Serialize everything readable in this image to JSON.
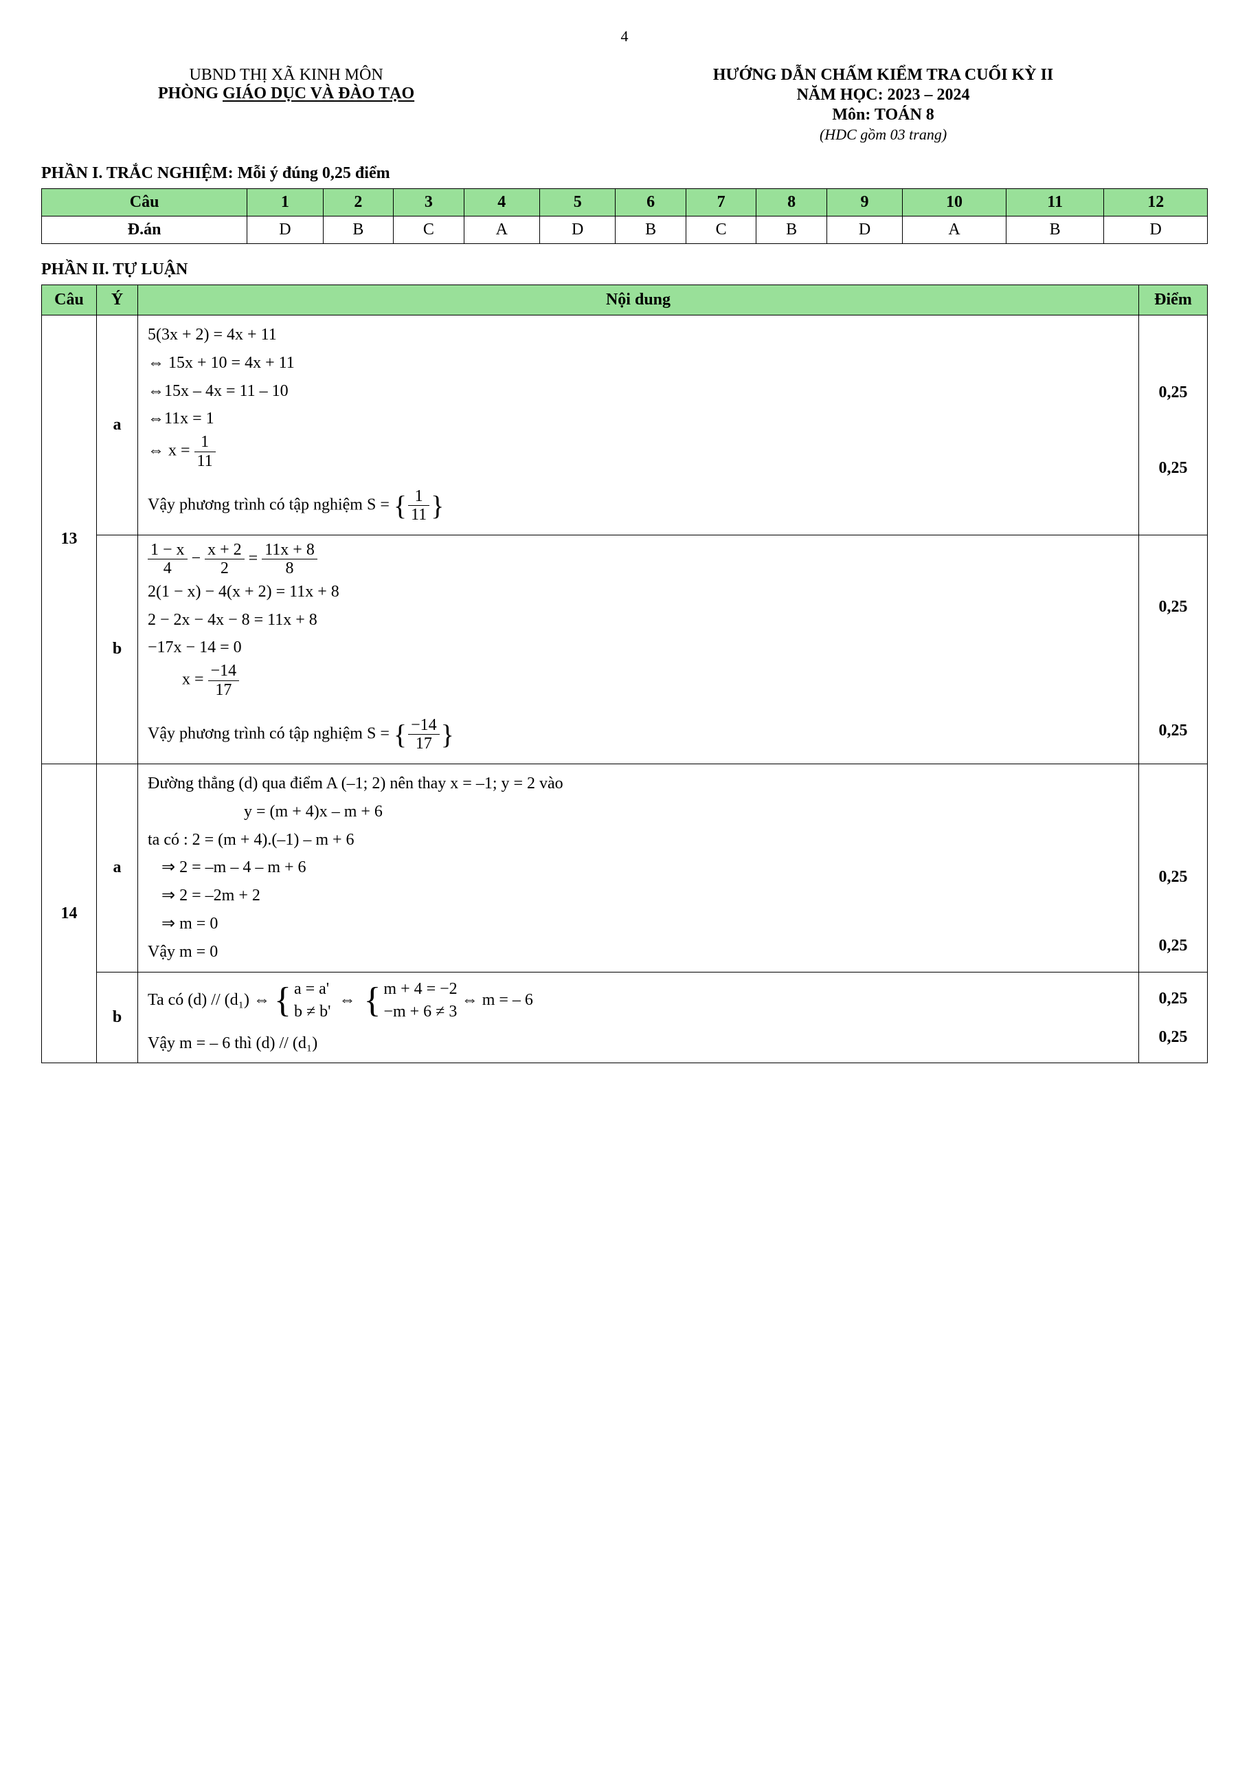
{
  "page_number": "4",
  "header": {
    "left_line1": "UBND THỊ XÃ KINH MÔN",
    "left_line2_prefix": "PHÒNG ",
    "left_line2_underline": "GIÁO DỤC VÀ ĐÀO TẠO",
    "right_line1": "HƯỚNG DẪN CHẤM KIỂM TRA CUỐI KỲ II",
    "right_line2": "NĂM HỌC: 2023 – 2024",
    "right_line3": "Môn:  TOÁN 8",
    "right_line4": "(HDC gồm 03 trang)"
  },
  "section1_title": "PHẦN I. TRẮC NGHIỆM: Mỗi ý đúng 0,25 điểm",
  "mc_table": {
    "row1_label": "Câu",
    "questions": [
      "1",
      "2",
      "3",
      "4",
      "5",
      "6",
      "7",
      "8",
      "9",
      "10",
      "11",
      "12"
    ],
    "row2_label": "Đ.án",
    "answers": [
      "D",
      "B",
      "C",
      "A",
      "D",
      "B",
      "C",
      "B",
      "D",
      "A",
      "B",
      "D"
    ]
  },
  "section2_title": "PHẦN II. TỰ LUẬN",
  "essay_headers": {
    "cau": "Câu",
    "y": "Ý",
    "noidung": "Nội dung",
    "diem": "Điểm"
  },
  "q13": {
    "label": "13",
    "a": {
      "label": "a",
      "line1": "5(3x + 2) = 4x + 11",
      "line2": "⇔ 15x + 10 = 4x + 11",
      "line3": "⇔15x – 4x = 11 – 10",
      "line4": "⇔11x        =  1",
      "line5_prefix": "⇔    x        =  ",
      "frac_num": "1",
      "frac_den": "11",
      "conclusion_prefix": "Vậy phương trình có tập nghiệm S = ",
      "set_num": "1",
      "set_den": "11",
      "score1": "0,25",
      "score2": "0,25"
    },
    "b": {
      "label": "b",
      "eq_lhs1_num": "1 − x",
      "eq_lhs1_den": "4",
      "eq_lhs2_num": "x + 2",
      "eq_lhs2_den": "2",
      "eq_rhs_num": "11x + 8",
      "eq_rhs_den": "8",
      "minus": "−",
      "equals": "=",
      "line2": "2(1 − x) − 4(x + 2) = 11x + 8",
      "line3": "2 − 2x − 4x − 8 = 11x + 8",
      "line4": "−17x − 14 = 0",
      "line5_prefix": "x = ",
      "line5_num": "−14",
      "line5_den": "17",
      "conclusion_prefix": "Vậy phương trình có tập nghiệm S = ",
      "set_num": "−14",
      "set_den": "17",
      "score1": "0,25",
      "score2": "0,25"
    }
  },
  "q14": {
    "label": "14",
    "a": {
      "label": "a",
      "line1": "Đường thẳng (d) qua điểm A (–1; 2) nên thay x = –1; y = 2 vào",
      "line2": "y = (m + 4)x – m + 6",
      "line3": "ta có : 2 = (m + 4).(–1) – m + 6",
      "line4": "⇒ 2 = –m – 4 – m + 6",
      "line5": "⇒ 2 = –2m + 2",
      "line6": "⇒ m = 0",
      "line7": "Vậy m = 0",
      "score1": "0,25",
      "score2": "0,25"
    },
    "b": {
      "label": "b",
      "prefix": "Ta có (d) // (d₁) ⇔ ",
      "case1_line1": "a = a'",
      "case1_line2": "b ≠ b'",
      "iff": "⇔",
      "case2_line1": "m + 4 = −2",
      "case2_line2": "−m + 6 ≠ 3",
      "result": " ⇔  m = – 6",
      "conclusion": "Vậy m = – 6 thì (d) // (d₁)",
      "score1": "0,25",
      "score2": "0,25"
    }
  }
}
